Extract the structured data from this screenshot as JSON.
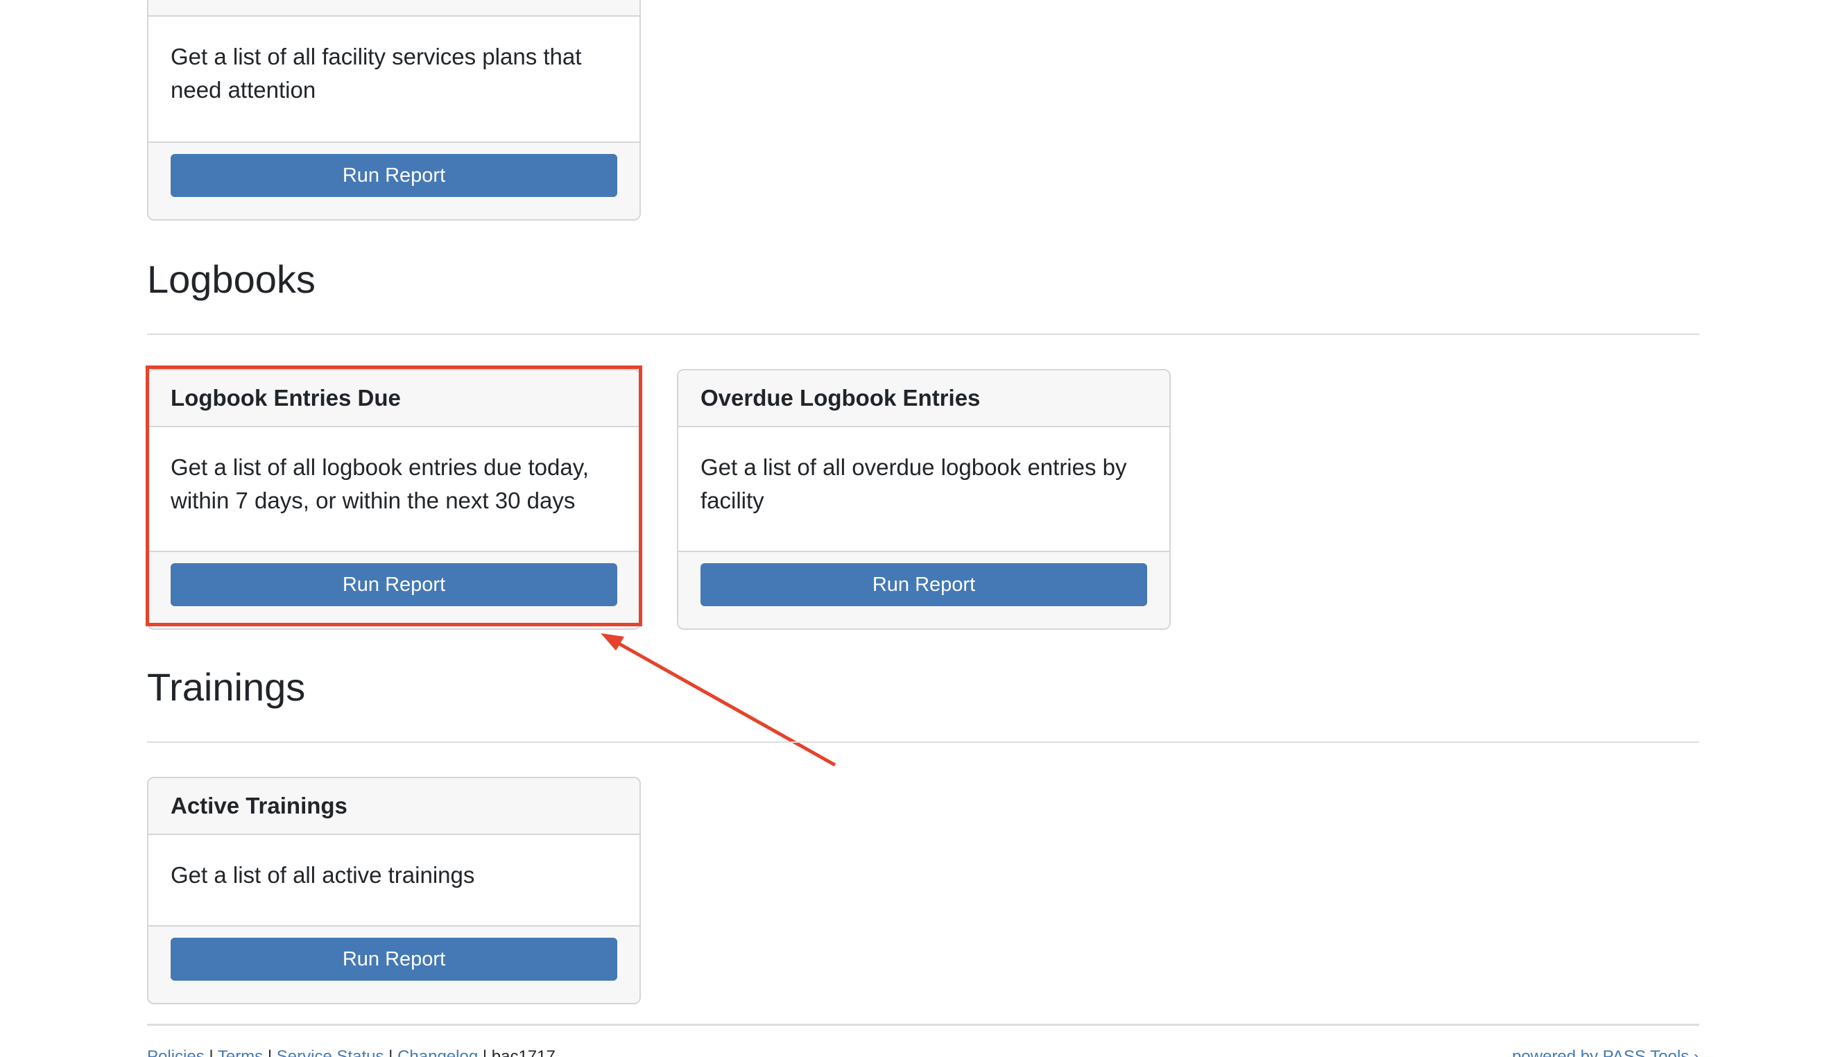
{
  "facility_card": {
    "description": "Get a list of all facility services plans that need attention",
    "button_label": "Run Report"
  },
  "logbooks": {
    "section_title": "Logbooks",
    "cards": [
      {
        "title": "Logbook Entries Due",
        "description": "Get a list of all logbook entries due today, within 7 days, or within the next 30 days",
        "button_label": "Run Report"
      },
      {
        "title": "Overdue Logbook Entries",
        "description": "Get a list of all overdue logbook entries by facility",
        "button_label": "Run Report"
      }
    ]
  },
  "trainings": {
    "section_title": "Trainings",
    "cards": [
      {
        "title": "Active Trainings",
        "description": "Get a list of all active trainings",
        "button_label": "Run Report"
      }
    ]
  },
  "footer": {
    "links": [
      "Policies",
      "Terms",
      "Service Status",
      "Changelog"
    ],
    "user": "bac1717",
    "powered_by": "powered by PASS Tools"
  },
  "colors": {
    "button": "#4579b5",
    "highlight": "#e5432b"
  }
}
